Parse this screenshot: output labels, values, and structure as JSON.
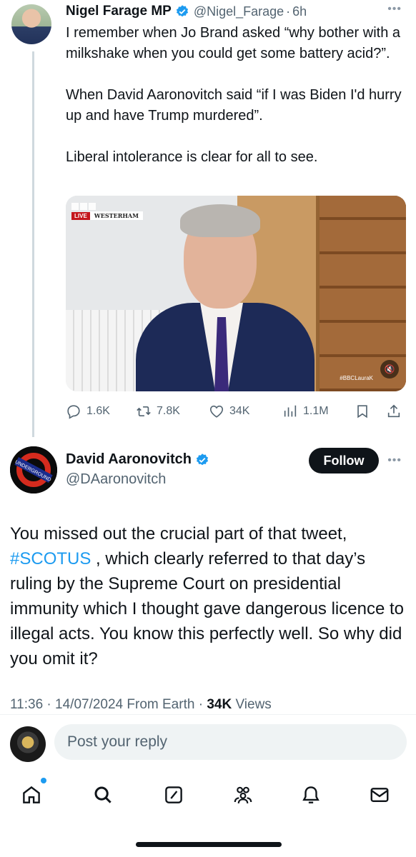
{
  "parent_tweet": {
    "author_name": "Nigel Farage MP",
    "handle": "@Nigel_Farage",
    "separator": "·",
    "time": "6h",
    "text_paragraphs": [
      "I remember when Jo Brand asked “why bother with a milkshake when you could get some battery acid?”.",
      "When David Aaronovitch said “if I was Biden I'd hurry up and have Trump murdered”.",
      "Liberal intolerance is clear for all to see."
    ],
    "video": {
      "live_label": "LIVE",
      "location_label": "WESTERHAM",
      "watermark": "#BBCLauraK",
      "muted_icon": "speaker-muted-icon"
    },
    "stats": {
      "replies": "1.6K",
      "reposts": "7.8K",
      "likes": "34K",
      "views": "1.1M"
    }
  },
  "main_tweet": {
    "author_name": "David Aaronovitch",
    "handle": "@DAaronovitch",
    "follow_label": "Follow",
    "text_before": "You missed out the crucial part of that tweet, ",
    "hashtag": "#SCOTUS",
    "text_after": " , which clearly referred to that day’s ruling by the Supreme Court on presidential immunity which I thought gave dangerous licence to illegal acts. You know this perfectly well. So why did you omit it?",
    "meta_time": "11:36",
    "meta_date": "14/07/2024",
    "meta_source": "From Earth",
    "meta_views_count": "34K",
    "meta_views_label": "Views",
    "avatar_text": "UNDERGROUND"
  },
  "reply_box": {
    "placeholder": "Post your reply"
  },
  "colors": {
    "accent": "#1d9bf0",
    "text": "#0f1419",
    "secondary": "#536471"
  }
}
